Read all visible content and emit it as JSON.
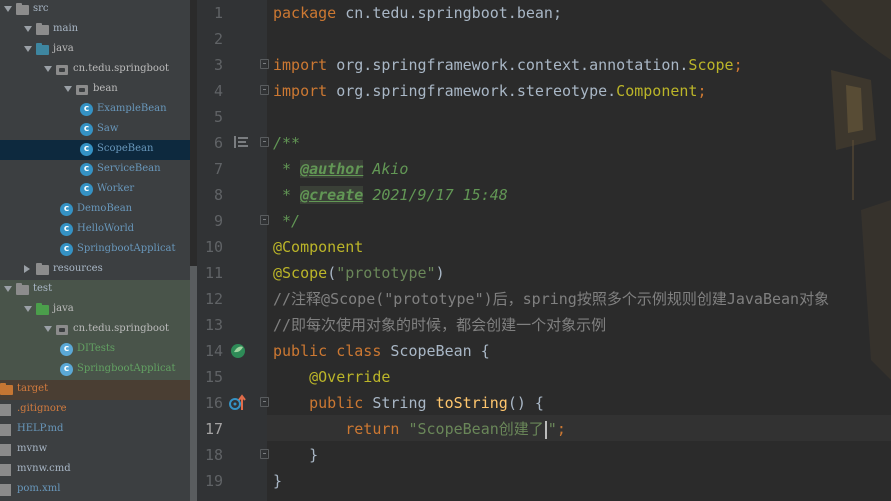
{
  "project_tree": {
    "items": [
      {
        "label": "src",
        "kind": "folder",
        "color": "gray"
      },
      {
        "label": "main",
        "kind": "folder",
        "color": "gray"
      },
      {
        "label": "java",
        "kind": "folder",
        "color": "blue"
      },
      {
        "label": "cn.tedu.springboot",
        "kind": "package",
        "color": "java"
      },
      {
        "label": "bean",
        "kind": "package",
        "color": "java"
      },
      {
        "label": "ExampleBean",
        "kind": "class",
        "color": "class"
      },
      {
        "label": "Saw",
        "kind": "class",
        "color": "class"
      },
      {
        "label": "ScopeBean",
        "kind": "class",
        "color": "class",
        "selected": true
      },
      {
        "label": "ServiceBean",
        "kind": "class",
        "color": "class"
      },
      {
        "label": "Worker",
        "kind": "class",
        "color": "class"
      },
      {
        "label": "DemoBean",
        "kind": "class",
        "color": "class"
      },
      {
        "label": "HelloWorld",
        "kind": "class",
        "color": "class"
      },
      {
        "label": "SpringbootApplicat",
        "kind": "class",
        "color": "class"
      },
      {
        "label": "resources",
        "kind": "folder",
        "color": "gray"
      },
      {
        "label": "test",
        "kind": "folder",
        "color": "gray"
      },
      {
        "label": "java",
        "kind": "folder",
        "color": "green"
      },
      {
        "label": "cn.tedu.springboot",
        "kind": "package",
        "color": "java"
      },
      {
        "label": "DITests",
        "kind": "class",
        "color": "test"
      },
      {
        "label": "SpringbootApplicat",
        "kind": "class",
        "color": "test"
      },
      {
        "label": "target",
        "kind": "folder",
        "color": "orange"
      },
      {
        "label": ".gitignore",
        "kind": "file",
        "color": "orange"
      },
      {
        "label": "HELP.md",
        "kind": "file",
        "color": "class"
      },
      {
        "label": "mvnw",
        "kind": "file",
        "color": "gray"
      },
      {
        "label": "mvnw.cmd",
        "kind": "file",
        "color": "gray"
      },
      {
        "label": "pom.xml",
        "kind": "file",
        "color": "class"
      }
    ]
  },
  "editor": {
    "line_numbers": [
      "1",
      "2",
      "3",
      "4",
      "5",
      "6",
      "7",
      "8",
      "9",
      "10",
      "11",
      "12",
      "13",
      "14",
      "15",
      "16",
      "17",
      "18",
      "19"
    ],
    "current_line": "17",
    "code": {
      "l1_kw": "package",
      "l1_rest": " cn.tedu.springboot.bean;",
      "l3_kw": "import",
      "l3_rest": " org.springframework.context.annotation.",
      "l3_ann": "Scope",
      "l3_end": ";",
      "l4_kw": "import",
      "l4_rest": " org.springframework.stereotype.",
      "l4_ann": "Component",
      "l4_end": ";",
      "l6": "/**",
      "l7_star": " * ",
      "l7_tag": "@author",
      "l7_val": " Akio",
      "l8_star": " * ",
      "l8_tag": "@create",
      "l8_val": " 2021/9/17 15:48",
      "l9": " */",
      "l10": "@Component",
      "l11_ann": "@Scope",
      "l11_p1": "(",
      "l11_str": "\"prototype\"",
      "l11_p2": ")",
      "l12": "//注释@Scope(\"prototype\")后，spring按照多个示例规则创建JavaBean对象",
      "l13": "//即每次使用对象的时候，都会创建一个对象示例",
      "l14_kw": "public class",
      "l14_rest": " ScopeBean {",
      "l15": "    @Override",
      "l16_kw": "    public",
      "l16_type": " String ",
      "l16_fn": "toString",
      "l16_rest": "() {",
      "l17_kw": "        return",
      "l17_str_a": " \"ScopeBean创建了",
      "l17_str_b": "\"",
      "l17_end": ";",
      "l18": "    }",
      "l19": "}"
    }
  }
}
